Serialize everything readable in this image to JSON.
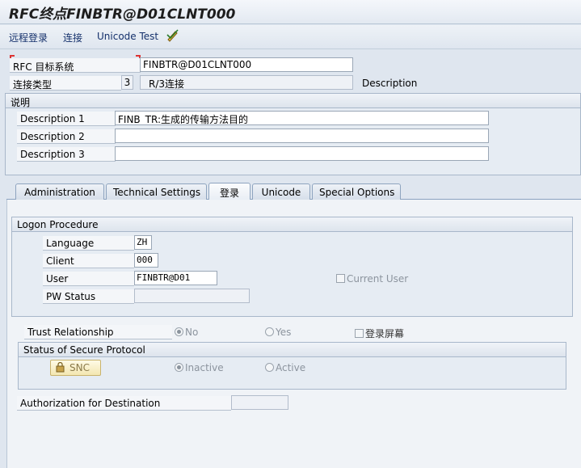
{
  "window": {
    "title": "RFC终点FINBTR@D01CLNT000"
  },
  "toolbar": {
    "remote_login": "远程登录",
    "connect": "连接",
    "unicode_test": "Unicode Test"
  },
  "header": {
    "rfc_target_label": "RFC 目标系统",
    "rfc_target_value": "FINBTR@D01CLNT000",
    "conn_type_label": "连接类型",
    "conn_type_code": "3",
    "conn_type_value": "R/3连接",
    "description_label": "Description"
  },
  "description_group": {
    "title": "说明",
    "rows": [
      {
        "label": "Description 1",
        "value": "FINB_TR:生成的传输方法目的"
      },
      {
        "label": "Description 2",
        "value": ""
      },
      {
        "label": "Description 3",
        "value": ""
      }
    ]
  },
  "tabs": [
    {
      "label": "Administration"
    },
    {
      "label": "Technical Settings"
    },
    {
      "label": "登录"
    },
    {
      "label": "Unicode"
    },
    {
      "label": "Special Options"
    }
  ],
  "logon": {
    "title": "Logon Procedure",
    "language_label": "Language",
    "language_value": "ZH",
    "client_label": "Client",
    "client_value": "000",
    "user_label": "User",
    "user_value": "FINBTR@D01",
    "pw_status_label": "PW Status",
    "pw_status_value": "",
    "current_user_label": "Current User"
  },
  "trust": {
    "label": "Trust Relationship",
    "no_label": "No",
    "yes_label": "Yes",
    "login_screen_label": "登录屏幕"
  },
  "secure": {
    "title": "Status of Secure Protocol",
    "snc_label": "SNC",
    "inactive_label": "Inactive",
    "active_label": "Active"
  },
  "auth": {
    "label": "Authorization for Destination",
    "value": ""
  }
}
